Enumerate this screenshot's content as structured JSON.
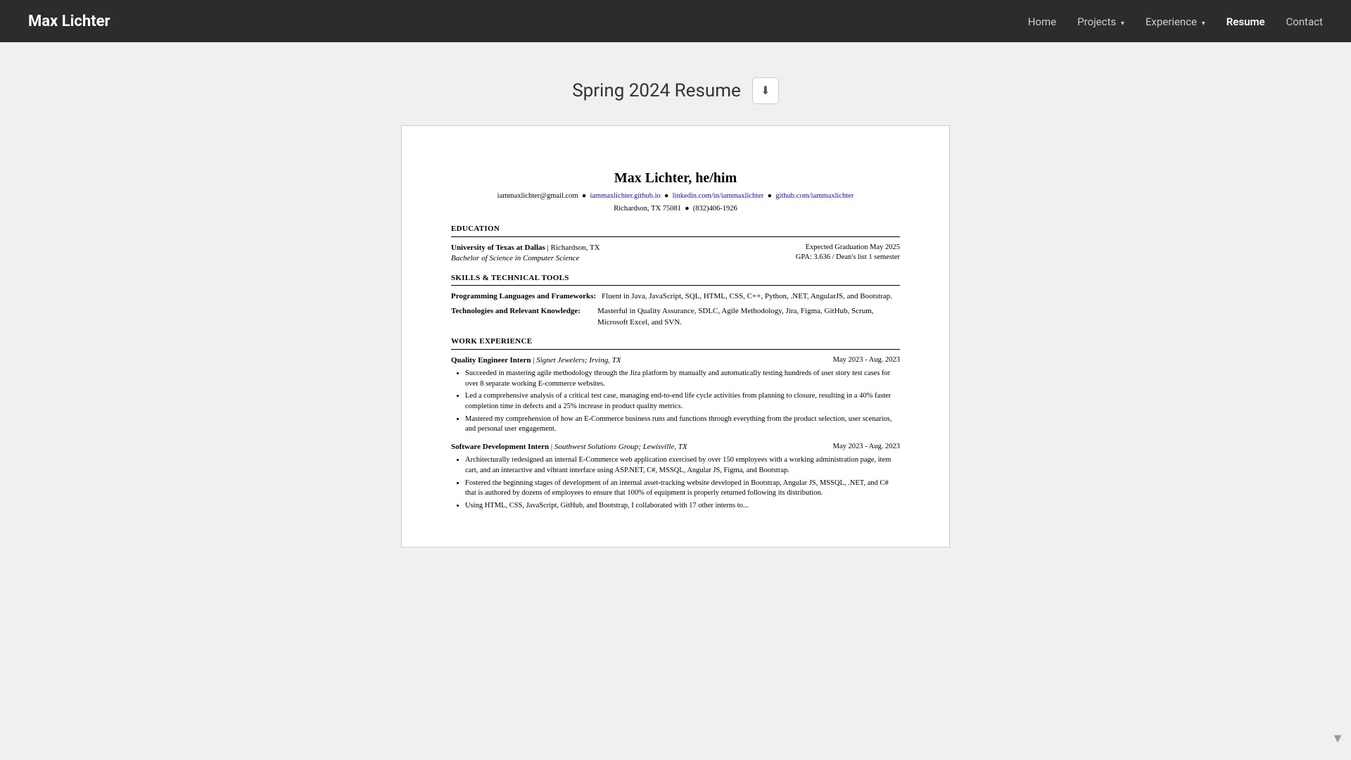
{
  "nav": {
    "brand": "Max Lichter",
    "links": [
      {
        "label": "Home",
        "active": false,
        "dropdown": false
      },
      {
        "label": "Projects",
        "active": false,
        "dropdown": true
      },
      {
        "label": "Experience",
        "active": false,
        "dropdown": true
      },
      {
        "label": "Resume",
        "active": true,
        "dropdown": false
      },
      {
        "label": "Contact",
        "active": false,
        "dropdown": false
      }
    ]
  },
  "page": {
    "title": "Spring 2024 Resume",
    "download_icon": "⬇"
  },
  "resume": {
    "name": "Max Lichter, he/him",
    "email": "iammaxlichter@gmail.com",
    "github_pages": "iammaxlichter.github.io",
    "linkedin": "linkedin.com/in/iammaxlichter",
    "github": "github.com/iammaxlichter",
    "location": "Richardson, TX 75081",
    "phone": "(832)406-1926",
    "sections": {
      "education": {
        "title": "EDUCATION",
        "school": "University of Texas at Dallas",
        "school_location": "Richardson, TX",
        "degree": "Bachelor of Science in Computer Science",
        "graduation": "Expected Graduation May 2025",
        "gpa": "GPA: 3.636 / Dean's list 1 semester"
      },
      "skills": {
        "title": "SKILLS & TECHNICAL TOOLS",
        "items": [
          {
            "label": "Programming Languages and Frameworks:",
            "value": "Fluent in Java, JavaScript, SQL, HTML, CSS, C++, Python, .NET, AngularJS, and Bootstrap."
          },
          {
            "label": "Technologies and Relevant Knowledge:",
            "value": "Masterful in Quality Assurance, SDLC, Agile Methodology, Jira, Figma, GitHub, Scrum, Microsoft Excel, and SVN."
          }
        ]
      },
      "work": {
        "title": "WORK EXPERIENCE",
        "jobs": [
          {
            "title": "Quality Engineer Intern",
            "company": "Signet Jewelers;",
            "location": "Irving, TX",
            "dates": "May 2023 - Aug. 2023",
            "bullets": [
              "Succeeded in mastering agile methodology through the Jira platform by manually and automatically testing hundreds of user story test cases for over 8 separate working E-commerce websites.",
              "Led a comprehensive analysis of a critical test case, managing end-to-end life cycle activities from planning to closure, resulting in a 40% faster completion time in defects and a 25% increase in product quality metrics.",
              "Mastered my comprehension of how an E-Commerce business runs and functions through everything from the product selection, user scenarios, and personal user engagement."
            ]
          },
          {
            "title": "Software Development Intern",
            "company": "Southwest Solutions Group;",
            "location": "Lewisville, TX",
            "dates": "May 2023 - Aug. 2023",
            "bullets": [
              "Architecturally redesigned an internal E-Commerce web application exercised by over 150 employees with a working administration page, item cart, and an interactive and vibrant interface using ASP.NET, C#, MSSQL, Angular JS, Figma, and Bootstrap.",
              "Fostered the beginning stages of development of an internal asset-tracking website developed in Bootstrap, Angular JS, MSSQL, .NET, and C# that is authored by dozens of employees to ensure that 100% of equipment is properly returned following its distribution.",
              "Using HTML, CSS, JavaScript, GitHub, and Bootstrap, I collaborated with 17 other interns to..."
            ]
          }
        ]
      }
    }
  }
}
